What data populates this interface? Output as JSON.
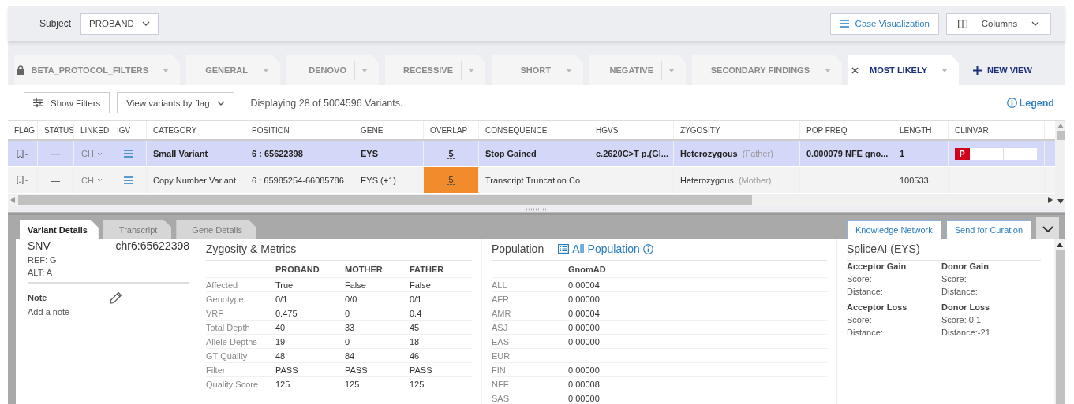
{
  "subject": {
    "label": "Subject",
    "value": "PROBAND"
  },
  "header_buttons": [
    {
      "kind": "visualization",
      "label": "Case Visualization"
    },
    {
      "kind": "columns",
      "label": "Columns"
    }
  ],
  "view_tabs": [
    {
      "label": "BETA_PROTOCOL_FILTERS",
      "locked": true,
      "selected": false
    },
    {
      "label": "GENERAL",
      "locked": false,
      "selected": false
    },
    {
      "label": "DENOVO",
      "locked": false,
      "selected": false
    },
    {
      "label": "RECESSIVE",
      "locked": false,
      "selected": false
    },
    {
      "label": "SHORT",
      "locked": false,
      "selected": false
    },
    {
      "label": "NEGATIVE",
      "locked": false,
      "selected": false
    },
    {
      "label": "SECONDARY FINDINGS",
      "locked": false,
      "selected": false
    },
    {
      "label": "MOST LIKELY",
      "locked": false,
      "selected": true
    }
  ],
  "new_view": "NEW VIEW",
  "toolbar": {
    "show_filters": "Show Filters",
    "flag_select": "View variants by flag",
    "summary": "Displaying 28 of 5004596 Variants.",
    "legend": "Legend"
  },
  "table": {
    "columns": [
      "FLAG",
      "STATUS",
      "LINKED",
      "IGV",
      "CATEGORY",
      "POSITION",
      "GENE",
      "OVERLAP",
      "CONSEQUENCE",
      "HGVS",
      "ZYGOSITY",
      "POP FREQ",
      "LENGTH",
      "CLINVAR"
    ],
    "rows": [
      {
        "selected": true,
        "status": "—",
        "linked": "CH",
        "category": "Small Variant",
        "position": "6 : 65622398",
        "gene": "EYS",
        "overlap": "5",
        "overlap_highlight": false,
        "consequence": "Stop Gained",
        "hgvs": "c.2620C>T p.(Gl...",
        "zygosity": "Heterozygous",
        "zygosity_parent": "(Father)",
        "pop_freq": "0.000079 NFE gno...",
        "length": "1",
        "clinvar": "P"
      },
      {
        "selected": false,
        "status": "—",
        "linked": "CH",
        "category": "Copy Number Variant",
        "position": "6 : 65985254-66085786",
        "gene": "EYS (+1)",
        "overlap": "5",
        "overlap_highlight": true,
        "consequence": "Transcript Truncation  Co",
        "zygosity": "Heterozygous",
        "zygosity_parent": "(Mother)",
        "length": "100533"
      }
    ]
  },
  "detail_tabs": [
    {
      "label": "Variant Details",
      "selected": true
    },
    {
      "label": "Transcript",
      "selected": false
    },
    {
      "label": "Gene Details",
      "selected": false
    }
  ],
  "actions": [
    "Knowledge Network",
    "Send for Curation"
  ],
  "variant": {
    "type": "SNV",
    "location": "chr6:65622398",
    "ref": "REF: G",
    "alt": "ALT: A",
    "note_label": "Note",
    "note_placeholder": "Add a note"
  },
  "zygosity": {
    "title": "Zygosity & Metrics",
    "columns": [
      "PROBAND",
      "MOTHER",
      "FATHER"
    ],
    "rows": [
      {
        "label": "Affected",
        "values": [
          "True",
          "False",
          "False"
        ]
      },
      {
        "label": "Genotype",
        "values": [
          "0/1",
          "0/0",
          "0/1"
        ]
      },
      {
        "label": "VRF",
        "values": [
          "0.475",
          "0",
          "0.4"
        ]
      },
      {
        "label": "Total Depth",
        "values": [
          "40",
          "33",
          "45"
        ]
      },
      {
        "label": "Allele Depths",
        "values": [
          "19",
          "0",
          "18"
        ]
      },
      {
        "label": "GT Quality",
        "values": [
          "48",
          "84",
          "46"
        ]
      },
      {
        "label": "Filter",
        "values": [
          "PASS",
          "PASS",
          "PASS"
        ]
      },
      {
        "label": "Quality Score",
        "values": [
          "125",
          "125",
          "125"
        ]
      }
    ]
  },
  "population": {
    "title": "Population",
    "link": "All Population",
    "column": "GnomAD",
    "rows": [
      {
        "label": "ALL",
        "value": "0.00004"
      },
      {
        "label": "AFR",
        "value": "0.00000"
      },
      {
        "label": "AMR",
        "value": "0.00004"
      },
      {
        "label": "ASJ",
        "value": "0.00000"
      },
      {
        "label": "EAS",
        "value": "0.00000"
      },
      {
        "label": "EUR"
      },
      {
        "label": "FIN",
        "value": "0.00000"
      },
      {
        "label": "NFE",
        "value": "0.00008"
      },
      {
        "label": "SAS",
        "value": "0.00000"
      }
    ]
  },
  "spliceai": {
    "title": "SpliceAI (EYS)",
    "groups": [
      {
        "title": "Acceptor Gain",
        "score": "Score:",
        "distance": "Distance:"
      },
      {
        "title": "Donor Gain",
        "score": "Score:",
        "distance": "Distance:"
      },
      {
        "title": "Acceptor Loss",
        "score": "Score:",
        "distance": "Distance:"
      },
      {
        "title": "Donor Loss",
        "score": "Score: 0.1",
        "distance": "Distance:-21"
      }
    ]
  }
}
